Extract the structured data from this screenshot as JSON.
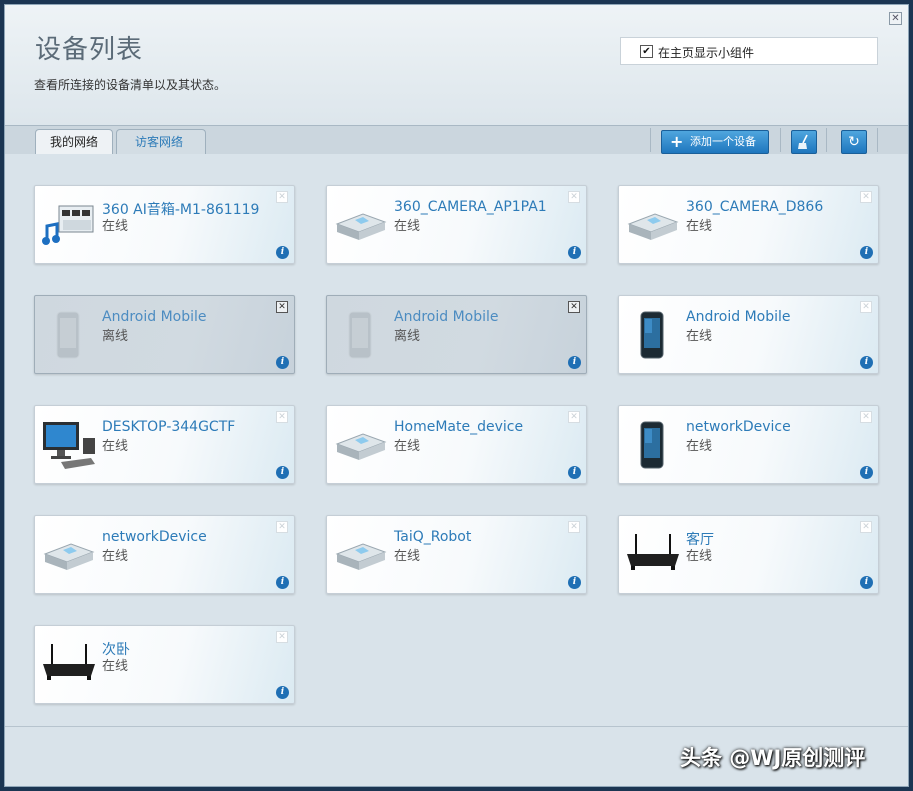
{
  "header": {
    "title": "设备列表",
    "subtitle": "查看所连接的设备清单以及其状态。",
    "widget_checkbox_mark": "✔",
    "widget_label": "在主页显示小组件"
  },
  "tabs": {
    "my_network": "我的网络",
    "guest_network": "访客网络"
  },
  "toolbar": {
    "add_label": "添加一个设备"
  },
  "devices": [
    {
      "name": "360 AI音箱-M1-861119",
      "status": "在线",
      "icon": "media-device-icon"
    },
    {
      "name": "360_CAMERA_AP1PA1",
      "status": "在线",
      "icon": "generic-device-icon"
    },
    {
      "name": "360_CAMERA_D866",
      "status": "在线",
      "icon": "generic-device-icon"
    },
    {
      "name": "Android Mobile",
      "status": "离线",
      "icon": "phone-icon"
    },
    {
      "name": "Android Mobile",
      "status": "离线",
      "icon": "phone-icon"
    },
    {
      "name": "Android Mobile",
      "status": "在线",
      "icon": "phone-icon"
    },
    {
      "name": "DESKTOP-344GCTF",
      "status": "在线",
      "icon": "computer-icon"
    },
    {
      "name": "HomeMate_device",
      "status": "在线",
      "icon": "generic-device-icon"
    },
    {
      "name": "networkDevice",
      "status": "在线",
      "icon": "phone-icon"
    },
    {
      "name": "networkDevice",
      "status": "在线",
      "icon": "generic-device-icon"
    },
    {
      "name": "TaiQ_Robot",
      "status": "在线",
      "icon": "generic-device-icon"
    },
    {
      "name": "客厅",
      "status": "在线",
      "icon": "router-icon"
    },
    {
      "name": "次卧",
      "status": "在线",
      "icon": "router-icon"
    }
  ],
  "watermark": "头条 @WJ原创测评",
  "colors": {
    "link": "#2d7bb8",
    "button": "#1e76be"
  }
}
